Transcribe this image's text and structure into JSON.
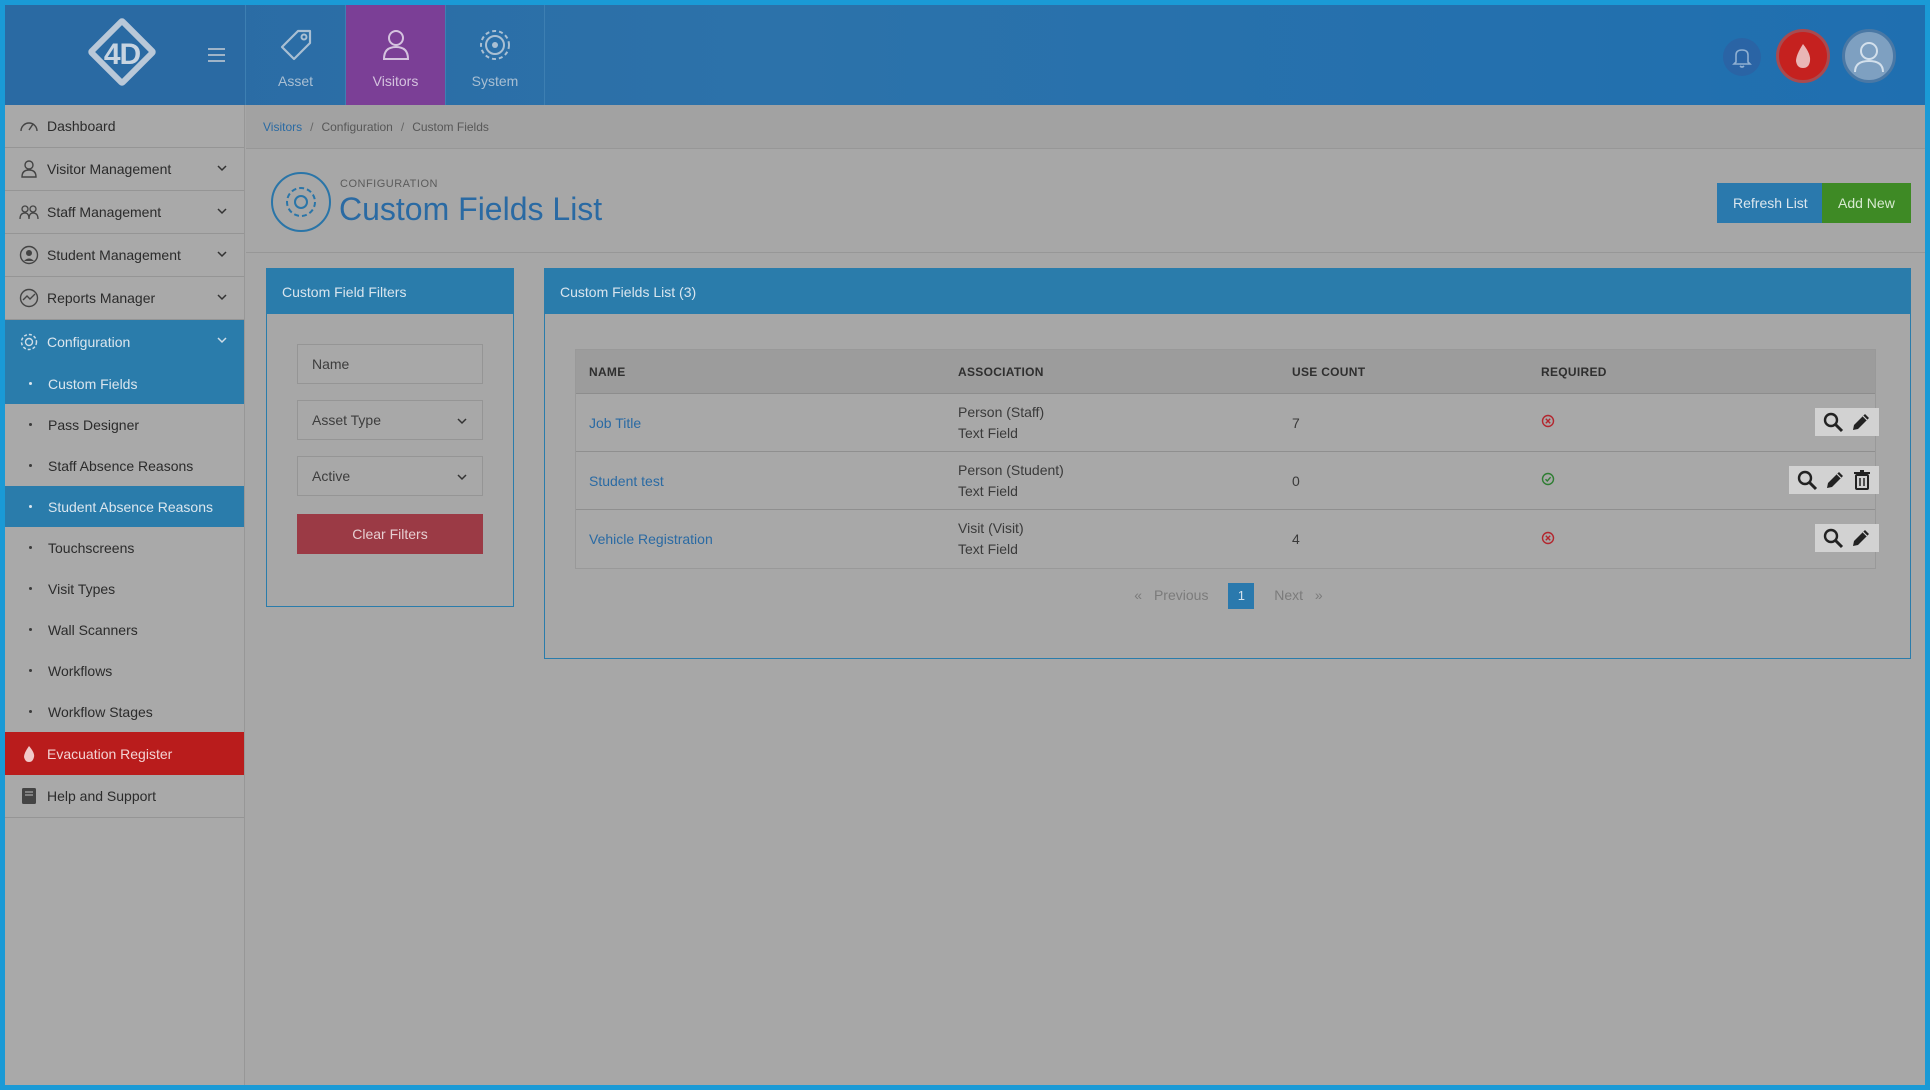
{
  "app": {
    "logo_text": "4D",
    "modules": [
      {
        "label": "Asset",
        "icon": "tag-icon",
        "active": false
      },
      {
        "label": "Visitors",
        "icon": "person-icon",
        "active": true
      },
      {
        "label": "System",
        "icon": "gear-icon",
        "active": false
      }
    ]
  },
  "sidebar": {
    "items": [
      {
        "label": "Dashboard",
        "icon": "dashboard-icon"
      },
      {
        "label": "Visitor Management",
        "icon": "visitor-icon"
      },
      {
        "label": "Staff Management",
        "icon": "staff-icon"
      },
      {
        "label": "Student Management",
        "icon": "student-icon"
      },
      {
        "label": "Reports Manager",
        "icon": "reports-icon"
      },
      {
        "label": "Configuration",
        "icon": "gear-icon"
      }
    ],
    "config_sub": [
      {
        "label": "Custom Fields",
        "selected": true
      },
      {
        "label": "Pass Designer",
        "selected": false
      },
      {
        "label": "Staff Absence Reasons",
        "selected": false
      },
      {
        "label": "Student Absence Reasons",
        "selected": true
      },
      {
        "label": "Touchscreens",
        "selected": false
      },
      {
        "label": "Visit Types",
        "selected": false
      },
      {
        "label": "Wall Scanners",
        "selected": false
      },
      {
        "label": "Workflows",
        "selected": false
      },
      {
        "label": "Workflow Stages",
        "selected": false
      }
    ],
    "evacuation": "Evacuation Register",
    "help": "Help and Support"
  },
  "breadcrumb": [
    "Visitors",
    "Configuration",
    "Custom Fields"
  ],
  "page": {
    "kicker": "CONFIGURATION",
    "title": "Custom Fields List",
    "refresh_label": "Refresh List",
    "add_label": "Add New"
  },
  "filters": {
    "title": "Custom Field Filters",
    "name_placeholder": "Name",
    "asset_type": "Asset Type",
    "status": "Active",
    "clear_label": "Clear Filters"
  },
  "list": {
    "title": "Custom Fields List (3)",
    "columns": [
      "NAME",
      "ASSOCIATION",
      "USE COUNT",
      "REQUIRED"
    ],
    "rows": [
      {
        "name": "Job Title",
        "assoc1": "Person (Staff)",
        "assoc2": "Text Field",
        "use_count": "7",
        "required": false
      },
      {
        "name": "Student test",
        "assoc1": "Person (Student)",
        "assoc2": "Text Field",
        "use_count": "0",
        "required": true
      },
      {
        "name": "Vehicle Registration",
        "assoc1": "Visit (Visit)",
        "assoc2": "Text Field",
        "use_count": "4",
        "required": false
      }
    ],
    "pager": {
      "prev": "Previous",
      "page": "1",
      "next": "Next"
    }
  },
  "colors": {
    "primary": "#2a7cab",
    "active_module": "#7b3f96",
    "danger": "#b91c1c",
    "success": "#3e8a25"
  }
}
